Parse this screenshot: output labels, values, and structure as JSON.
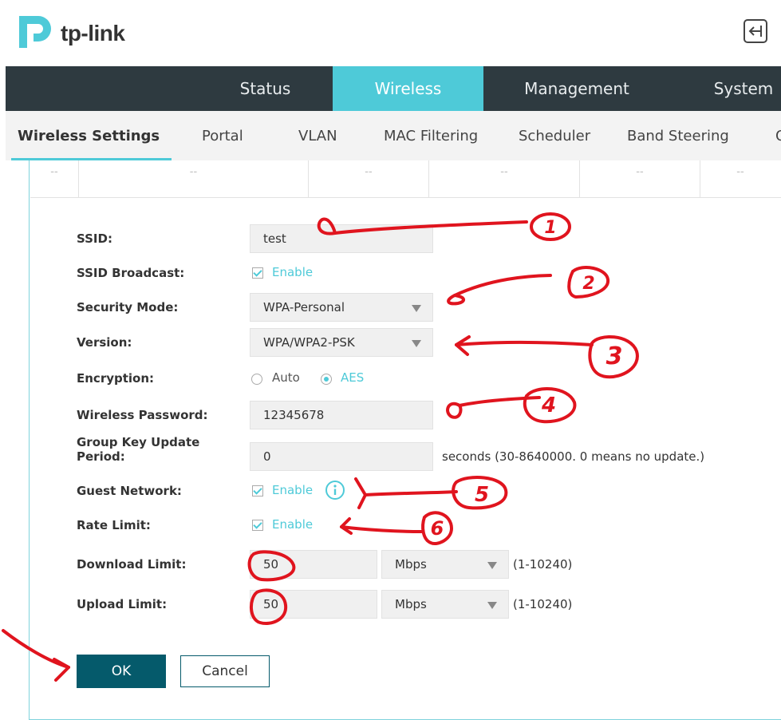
{
  "header": {
    "brand": "tp-link",
    "logout_icon": "logout-icon"
  },
  "main_nav": [
    {
      "label": "Status",
      "active": false
    },
    {
      "label": "Wireless",
      "active": true
    },
    {
      "label": "Management",
      "active": false
    },
    {
      "label": "System",
      "active": false
    }
  ],
  "sub_nav": [
    {
      "label": "Wireless Settings",
      "active": true
    },
    {
      "label": "Portal",
      "active": false
    },
    {
      "label": "VLAN",
      "active": false
    },
    {
      "label": "MAC Filtering",
      "active": false
    },
    {
      "label": "Scheduler",
      "active": false
    },
    {
      "label": "Band Steering",
      "active": false
    },
    {
      "label": "Q",
      "active": false
    }
  ],
  "table_stub": [
    "--",
    "--",
    "--",
    "--",
    "--",
    "--"
  ],
  "form": {
    "ssid": {
      "label": "SSID:",
      "value": "test"
    },
    "ssid_broadcast": {
      "label": "SSID Broadcast:",
      "checked": true,
      "option": "Enable"
    },
    "security_mode": {
      "label": "Security Mode:",
      "value": "WPA-Personal"
    },
    "version": {
      "label": "Version:",
      "value": "WPA/WPA2-PSK"
    },
    "encryption": {
      "label": "Encryption:",
      "options": [
        "Auto",
        "AES"
      ],
      "selected": "AES"
    },
    "wireless_password": {
      "label": "Wireless Password:",
      "value": "12345678"
    },
    "group_key": {
      "label": "Group Key Update Period:",
      "value": "0",
      "hint": "seconds (30-8640000. 0 means no update.)"
    },
    "guest_network": {
      "label": "Guest Network:",
      "checked": true,
      "option": "Enable"
    },
    "rate_limit": {
      "label": "Rate Limit:",
      "checked": true,
      "option": "Enable"
    },
    "download_limit": {
      "label": "Download Limit:",
      "value": "50",
      "unit": "Mbps",
      "range": "(1-10240)"
    },
    "upload_limit": {
      "label": "Upload Limit:",
      "value": "50",
      "unit": "Mbps",
      "range": "(1-10240)"
    }
  },
  "buttons": {
    "ok": "OK",
    "cancel": "Cancel"
  },
  "annotations": {
    "color": "#e0141e",
    "numbers": [
      "1",
      "2",
      "3",
      "4",
      "5",
      "6"
    ]
  },
  "colors": {
    "accent": "#4ecad8",
    "nav_bg": "#2e3a40",
    "ok_bg": "#055a6b"
  }
}
